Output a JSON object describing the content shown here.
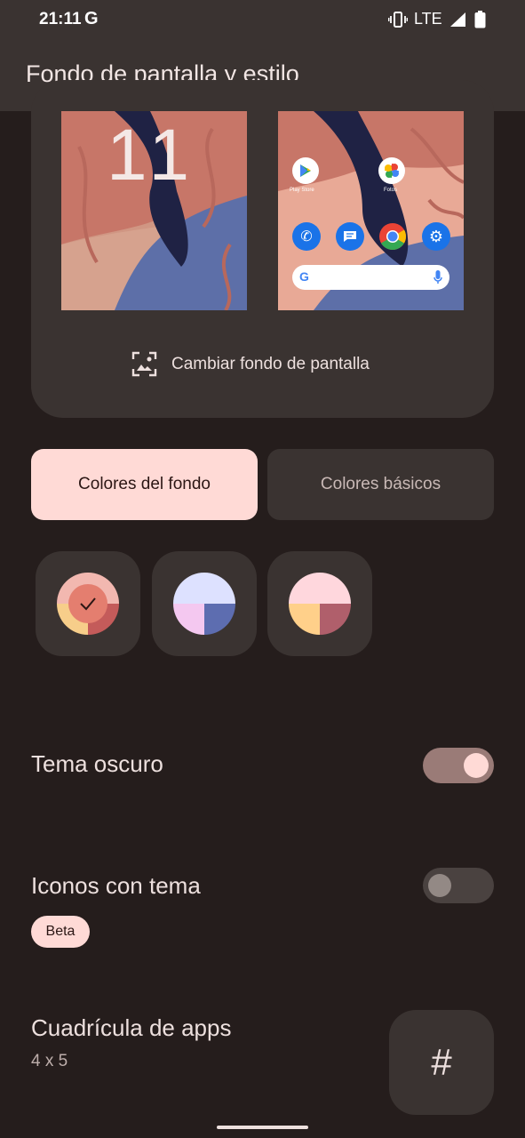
{
  "status_bar": {
    "time": "21:11",
    "g_label": "G",
    "network": "LTE"
  },
  "header": {
    "title": "Fondo de pantalla y estilo"
  },
  "preview": {
    "lock_clock": "11",
    "home_apps": [
      {
        "name": "Play Store"
      },
      {
        "name": "Fotos"
      }
    ],
    "change_wallpaper_label": "Cambiar fondo de pantalla"
  },
  "tabs": [
    {
      "label": "Colores del fondo",
      "selected": true
    },
    {
      "label": "Colores básicos",
      "selected": false
    }
  ],
  "swatches": [
    {
      "colors": [
        "#f2b8b0",
        "#f7ce8a",
        "#c45b5a"
      ],
      "selected": true
    },
    {
      "colors": [
        "#dde1ff",
        "#f4c8f0",
        "#5d6db0"
      ],
      "selected": false
    },
    {
      "colors": [
        "#ffd7dd",
        "#ffd08a",
        "#b05f6b"
      ],
      "selected": false
    }
  ],
  "settings": {
    "dark_theme": {
      "label": "Tema oscuro",
      "enabled": true
    },
    "themed_icons": {
      "label": "Iconos con tema",
      "enabled": false,
      "badge": "Beta"
    },
    "app_grid": {
      "label": "Cuadrícula de apps",
      "value": "4 x 5",
      "icon": "#"
    }
  },
  "colors": {
    "background": "#251d1c",
    "surface": "#3a3331",
    "accent": "#ffdad6",
    "toggle_on_track": "#9a7b77",
    "toggle_on_knob": "#ffdad6"
  }
}
